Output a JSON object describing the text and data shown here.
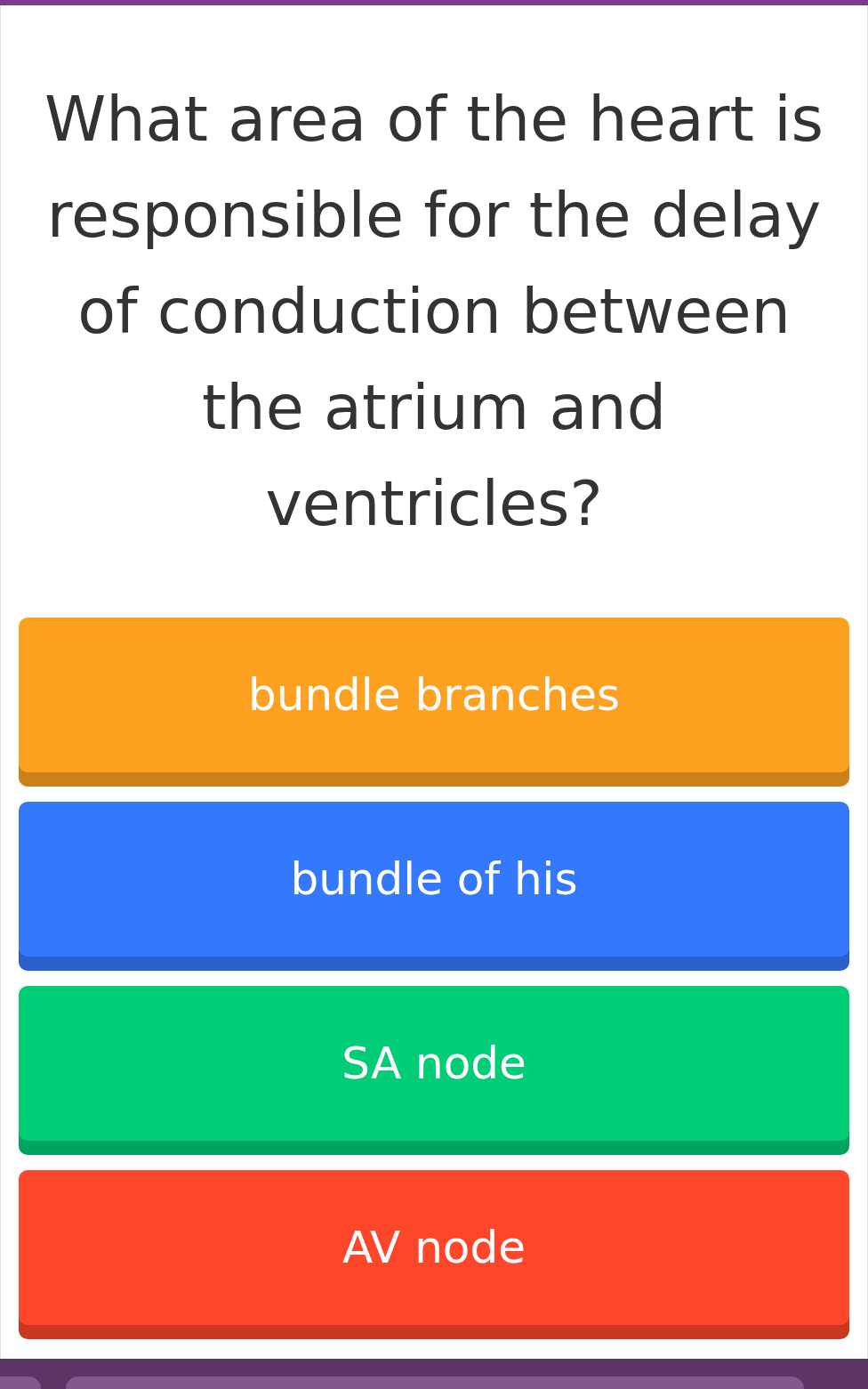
{
  "question": "What area of the heart is responsible for the delay of conduction between the atrium and ventricles?",
  "options": [
    {
      "label": "bundle branches",
      "color": "#fea120"
    },
    {
      "label": "bundle of his",
      "color": "#3478fe"
    },
    {
      "label": "SA node",
      "color": "#00cd76"
    },
    {
      "label": "AV node",
      "color": "#fe462b"
    }
  ]
}
